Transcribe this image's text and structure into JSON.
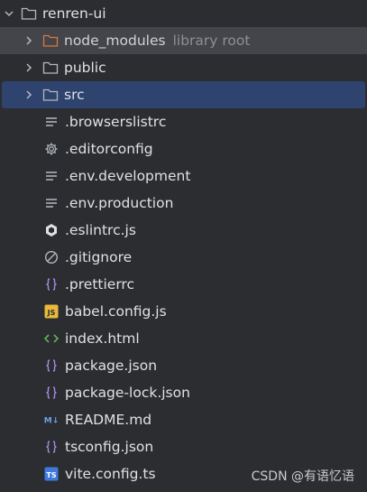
{
  "root": {
    "label": "renren-ui"
  },
  "items": [
    {
      "label": "node_modules",
      "hint": "library root",
      "kind": "folder-excluded"
    },
    {
      "label": "public",
      "kind": "folder"
    },
    {
      "label": "src",
      "kind": "folder"
    },
    {
      "label": ".browserslistrc",
      "kind": "text-file"
    },
    {
      "label": ".editorconfig",
      "kind": "config-file"
    },
    {
      "label": ".env.development",
      "kind": "text-file"
    },
    {
      "label": ".env.production",
      "kind": "text-file"
    },
    {
      "label": ".eslintrc.js",
      "kind": "eslint-file"
    },
    {
      "label": ".gitignore",
      "kind": "ignore-file"
    },
    {
      "label": ".prettierrc",
      "kind": "json-file"
    },
    {
      "label": "babel.config.js",
      "kind": "js-file"
    },
    {
      "label": "index.html",
      "kind": "html-file"
    },
    {
      "label": "package.json",
      "kind": "json-file"
    },
    {
      "label": "package-lock.json",
      "kind": "json-file"
    },
    {
      "label": "README.md",
      "kind": "markdown-file"
    },
    {
      "label": "tsconfig.json",
      "kind": "json-file"
    },
    {
      "label": "vite.config.ts",
      "kind": "ts-file"
    }
  ],
  "badges": {
    "js": "JS",
    "ts": "TS",
    "md": "M↓"
  },
  "watermark": "CSDN @有语忆语",
  "colors": {
    "background": "#2b2d30",
    "selected_row": "#2e436e",
    "highlight_row": "#43454a",
    "js_badge": "#e8b93c",
    "ts_badge": "#3d7ae0",
    "html_icon": "#5fb35a",
    "json_icon": "#a98ae6",
    "excluded_folder": "#d9773a"
  }
}
